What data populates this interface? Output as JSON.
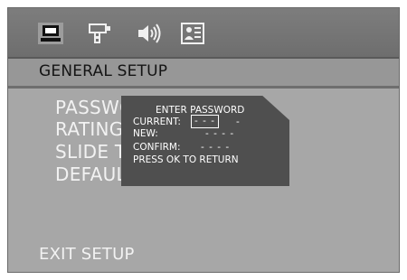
{
  "icons": [
    "general-setup-icon",
    "speaker-tv-icon",
    "audio-icon",
    "preference-icon"
  ],
  "section": {
    "title": "GENERAL SETUP"
  },
  "menu": {
    "items": [
      "PASSWO",
      "RATING",
      "SLIDE T",
      "DEFAUL"
    ]
  },
  "password_dialog": {
    "title": "ENTER PASSWORD",
    "current_label": "CURRENT:",
    "current_value": "- - -",
    "current_tail": "-",
    "new_label": "NEW:",
    "new_value": "- - - -",
    "confirm_label": "CONFIRM:",
    "confirm_value": "- - - -",
    "hint": "PRESS OK TO RETURN"
  },
  "footer": {
    "exit_label": "EXIT SETUP"
  },
  "colors": {
    "screen": "#a7a7a7",
    "icon_bar": "#767676",
    "section_bar": "#979797",
    "dialog": "#4f4f4f",
    "menu_text": "#f2f2f2"
  }
}
